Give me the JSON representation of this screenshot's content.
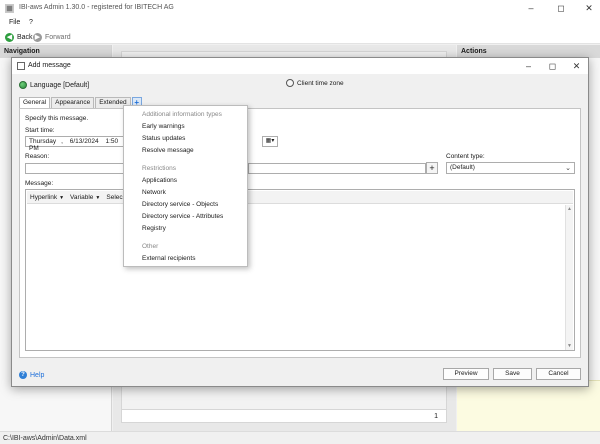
{
  "app": {
    "title": "IBI-aws Admin 1.30.0 - registered for IBITECH AG",
    "status_path": "C:\\IBI-aws\\Admin\\Data.xml"
  },
  "menu": {
    "file": "File",
    "help": "?"
  },
  "nav": {
    "back": "Back",
    "forward": "Forward"
  },
  "panes": {
    "navigation": "Navigation",
    "actions": "Actions",
    "center_count": "1"
  },
  "dialog": {
    "title": "Add message",
    "language": "Language [Default]",
    "tabs": [
      "General",
      "Appearance",
      "Extended",
      "+"
    ],
    "specify_text": "Specify this message.",
    "start_time_label": "Start time:",
    "start_date": {
      "day": "Thursday",
      "sep": ",",
      "date": "6/13/2024",
      "time": "1:50 PM"
    },
    "end_time_fragment": "PM",
    "client_time_zone": "Client time zone",
    "reason_label": "Reason:",
    "reason_value": "",
    "content_type_label": "Content type:",
    "content_type_value": "(Default)",
    "message_label": "Message:",
    "editor_toolbar": {
      "hyperlink": "Hyperlink",
      "variable": "Variable",
      "select_fragment": "Selec"
    },
    "help": "Help",
    "buttons": {
      "preview": "Preview",
      "save": "Save",
      "cancel": "Cancel"
    }
  },
  "popup": {
    "groups": [
      {
        "header": "Additional information types",
        "items": [
          "Early warnings",
          "Status updates",
          "Resolve message"
        ]
      },
      {
        "header": "Restrictions",
        "items": [
          "Applications",
          "Network",
          "Directory service - Objects",
          "Directory service - Attributes",
          "Registry"
        ]
      },
      {
        "header": "Other",
        "items": [
          "External recipients"
        ]
      }
    ]
  },
  "colors": {
    "accent": "#1e6fd9",
    "back_arrow": "#2e9e3f",
    "forward_arrow": "#9a9a9a"
  }
}
